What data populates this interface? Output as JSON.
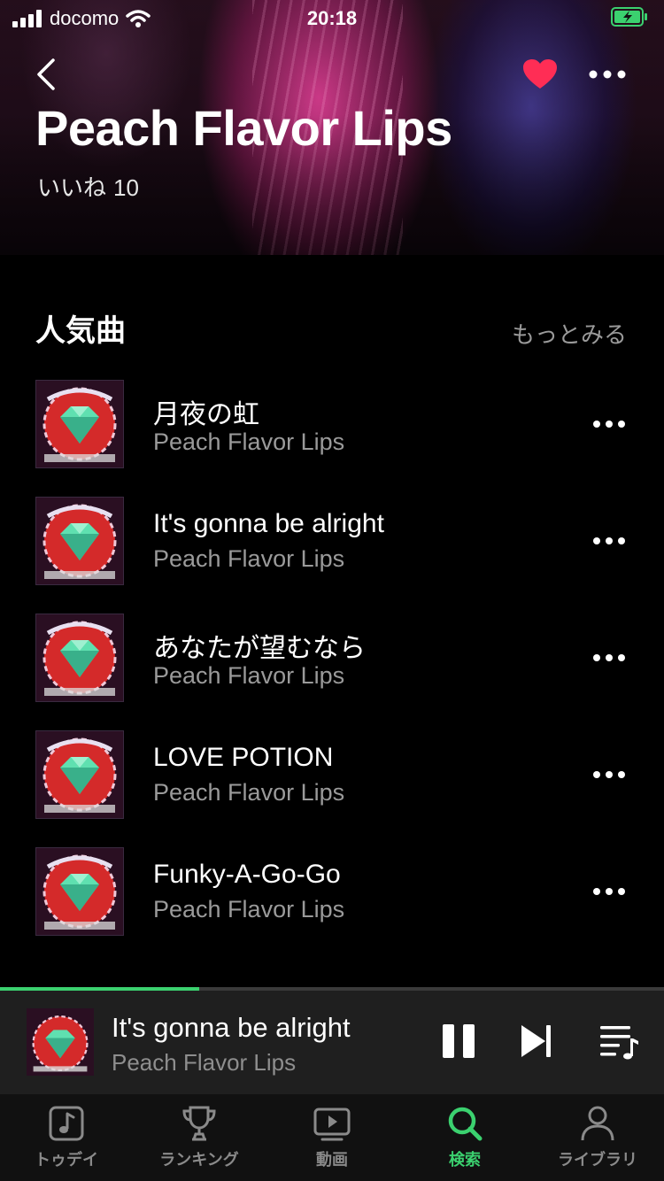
{
  "status_bar": {
    "carrier": "docomo",
    "time": "20:18"
  },
  "header": {
    "artist": "Peach Flavor Lips",
    "likes_label": "いいね",
    "likes_count": "10",
    "favorite": true,
    "icons": [
      "back-icon",
      "heart-icon",
      "more-icon"
    ]
  },
  "popular": {
    "title": "人気曲",
    "more_label": "もっとみる",
    "tracks": [
      {
        "name": "月夜の虹",
        "artist": "Peach Flavor Lips"
      },
      {
        "name": "It's gonna be alright",
        "artist": "Peach Flavor Lips"
      },
      {
        "name": "あなたが望むなら",
        "artist": "Peach Flavor Lips"
      },
      {
        "name": "LOVE POTION",
        "artist": "Peach Flavor Lips"
      },
      {
        "name": "Funky-A-Go-Go",
        "artist": "Peach Flavor Lips"
      }
    ]
  },
  "player": {
    "title": "It's gonna be alright",
    "artist": "Peach Flavor Lips",
    "progress": 0.3,
    "state": "playing"
  },
  "tabs": [
    {
      "label": "トゥデイ",
      "icon": "music-note-icon",
      "active": false
    },
    {
      "label": "ランキング",
      "icon": "trophy-icon",
      "active": false
    },
    {
      "label": "動画",
      "icon": "video-icon",
      "active": false
    },
    {
      "label": "検索",
      "icon": "search-icon",
      "active": true
    },
    {
      "label": "ライブラリ",
      "icon": "person-icon",
      "active": false
    }
  ],
  "colors": {
    "accent": "#3bd16f",
    "heart": "#ff2d55",
    "muted_text": "#9a9a9a",
    "background": "#000000",
    "player_bg": "#1f1f1f"
  }
}
